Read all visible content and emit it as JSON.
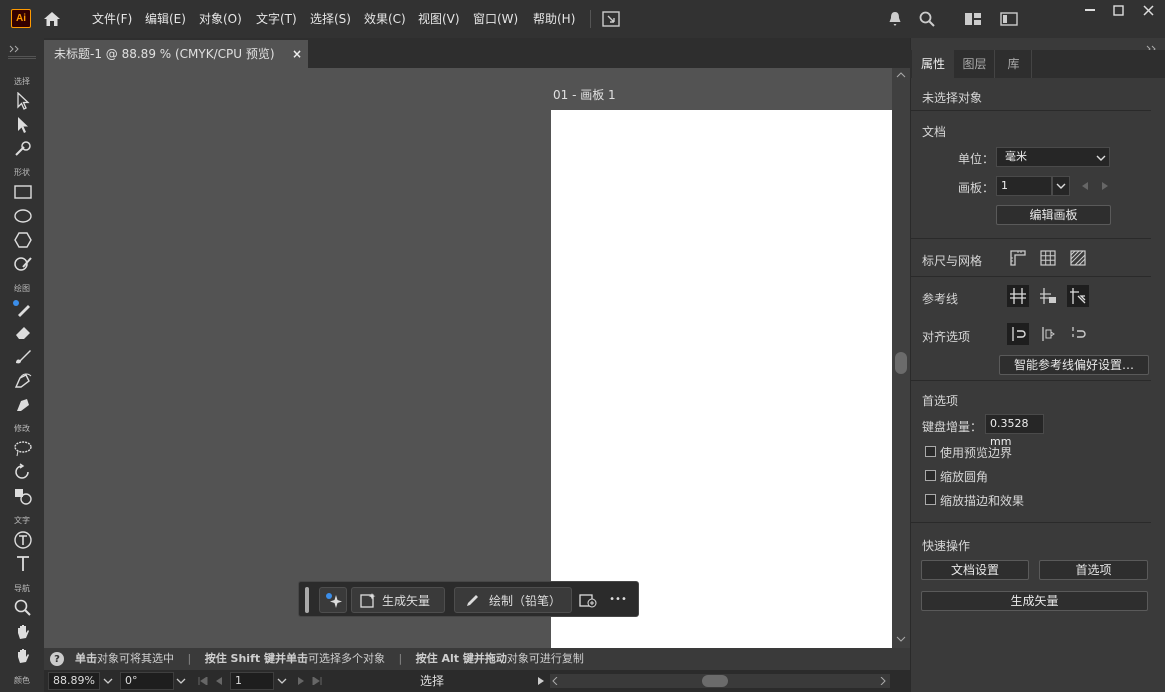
{
  "app": {
    "logo": "Ai"
  },
  "menu": [
    "文件(F)",
    "编辑(E)",
    "对象(O)",
    "文字(T)",
    "选择(S)",
    "效果(C)",
    "视图(V)",
    "窗口(W)",
    "帮助(H)"
  ],
  "toolbar": {
    "groups": [
      "选择",
      "形状",
      "绘图",
      "修改",
      "文字",
      "导航",
      "颜色"
    ]
  },
  "document": {
    "tab_title": "未标题-1 @ 88.89 % (CMYK/CPU 预览)",
    "close": "×",
    "artboard_label": "01 - 画板 1"
  },
  "context_bar": {
    "generate_vector": "生成矢量",
    "draw_pencil": "绘制（铅笔）",
    "more": "•••"
  },
  "status": {
    "hint1_bold": "单击",
    "hint1": "对象可将其选中",
    "sep": "|",
    "hint2_bold_a": "按住 Shift 键并单击",
    "hint2": "可选择多个对象",
    "hint3_bold": "按住 Alt 键并拖动",
    "hint3": "对象可进行复制"
  },
  "bottom": {
    "zoom": "88.89%",
    "rotation": "0°",
    "artboard_num": "1",
    "tool_name": "选择"
  },
  "panel": {
    "tabs": [
      "属性",
      "图层",
      "库"
    ],
    "no_selection": "未选择对象",
    "document_section": "文档",
    "unit_label": "单位：",
    "unit_value": "毫米",
    "artboard_label": "画板：",
    "artboard_value": "1",
    "edit_artboard": "编辑画板",
    "rulers_grids": "标尺与网格",
    "guides": "参考线",
    "snap_options": "对齐选项",
    "smart_guides_prefs": "智能参考线偏好设置…",
    "preferences": "首选项",
    "keyboard_increment_label": "键盘增量：",
    "keyboard_increment_value": "0.3528 mm",
    "use_preview_bounds": "使用预览边界",
    "scale_corners": "缩放圆角",
    "scale_strokes_effects": "缩放描边和效果",
    "quick_actions": "快速操作",
    "document_setup": "文档设置",
    "prefs_button": "首选项",
    "generate_vector_button": "生成矢量"
  }
}
